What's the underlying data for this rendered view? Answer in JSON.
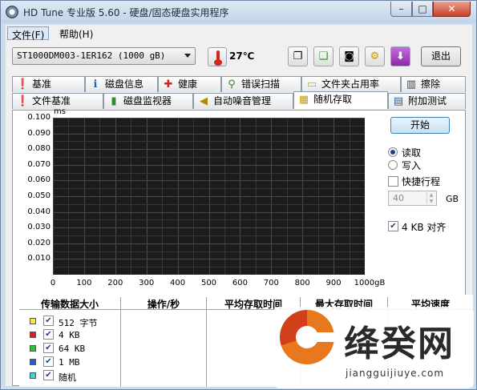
{
  "window": {
    "title": "HD Tune 专业版 5.60 - 硬盘/固态硬盘实用程序",
    "caption_buttons": [
      "–",
      "□",
      "✕"
    ]
  },
  "menu": {
    "file": "文件(F)",
    "help": "帮助(H)"
  },
  "toolbar": {
    "drive": "ST1000DM003-1ER162 (1000 gB)",
    "temperature": "27℃",
    "exit_label": "退出",
    "icons": [
      "copy-text-icon",
      "copy-screen-icon",
      "camera-icon",
      "tools-icon",
      "save-icon"
    ]
  },
  "tabs_row1": [
    {
      "label": "基准",
      "icon": "benchmark-icon",
      "glyph": "❗"
    },
    {
      "label": "磁盘信息",
      "icon": "info-icon",
      "glyph": "ℹ"
    },
    {
      "label": "健康",
      "icon": "health-cross-icon",
      "glyph": "✚"
    },
    {
      "label": "错误扫描",
      "icon": "magnifier-icon",
      "glyph": "🔍"
    },
    {
      "label": "文件夹占用率",
      "icon": "folder-icon",
      "glyph": "📁"
    },
    {
      "label": "擦除",
      "icon": "trash-icon",
      "glyph": "🗑"
    }
  ],
  "tabs_row2": [
    {
      "label": "文件基准",
      "icon": "file-benchmark-icon",
      "glyph": "❗"
    },
    {
      "label": "磁盘监视器",
      "icon": "monitor-chart-icon",
      "glyph": "▮"
    },
    {
      "label": "自动噪音管理",
      "icon": "speaker-icon",
      "glyph": "🔊"
    },
    {
      "label": "随机存取",
      "icon": "random-access-icon",
      "glyph": "▦"
    },
    {
      "label": "附加测试",
      "icon": "extra-tests-icon",
      "glyph": "▤"
    }
  ],
  "active_tab": "随机存取",
  "chart_data": {
    "type": "scatter",
    "title": "",
    "ylabel": "ms",
    "xlabel": "",
    "y_ticks": [
      "0.100",
      "0.090",
      "0.080",
      "0.070",
      "0.060",
      "0.050",
      "0.040",
      "0.030",
      "0.020",
      "0.010"
    ],
    "x_ticks": [
      "0",
      "100",
      "200",
      "300",
      "400",
      "500",
      "600",
      "700",
      "800",
      "900",
      "1000gB"
    ],
    "xlim": [
      0,
      1000
    ],
    "ylim": [
      0,
      0.1
    ],
    "grid": true,
    "background": "#1c1c1c",
    "series": []
  },
  "controls": {
    "start_label": "开始",
    "read_label": "读取",
    "write_label": "写入",
    "selected_mode": "read",
    "quick_stroke_label": "快捷行程",
    "quick_stroke_checked": false,
    "quick_stroke_value": "40",
    "quick_stroke_unit": "GB",
    "align_label": "4 KB 对齐",
    "align_checked": true
  },
  "results": {
    "headers": [
      "传输数据大小",
      "操作/秒",
      "平均存取时间",
      "最大存取时间",
      "平均速度"
    ],
    "rows": [
      {
        "label": "512 字节",
        "color": "#f5e642",
        "checked": true
      },
      {
        "label": "4 KB",
        "color": "#d62020",
        "checked": true
      },
      {
        "label": "64 KB",
        "color": "#2ec22e",
        "checked": true
      },
      {
        "label": "1 MB",
        "color": "#2a5bd7",
        "checked": true
      },
      {
        "label": "随机",
        "color": "#3ad4d4",
        "checked": true
      }
    ]
  },
  "watermark": {
    "brand": "绛癸网",
    "url": "jiangguijiuye.com"
  }
}
